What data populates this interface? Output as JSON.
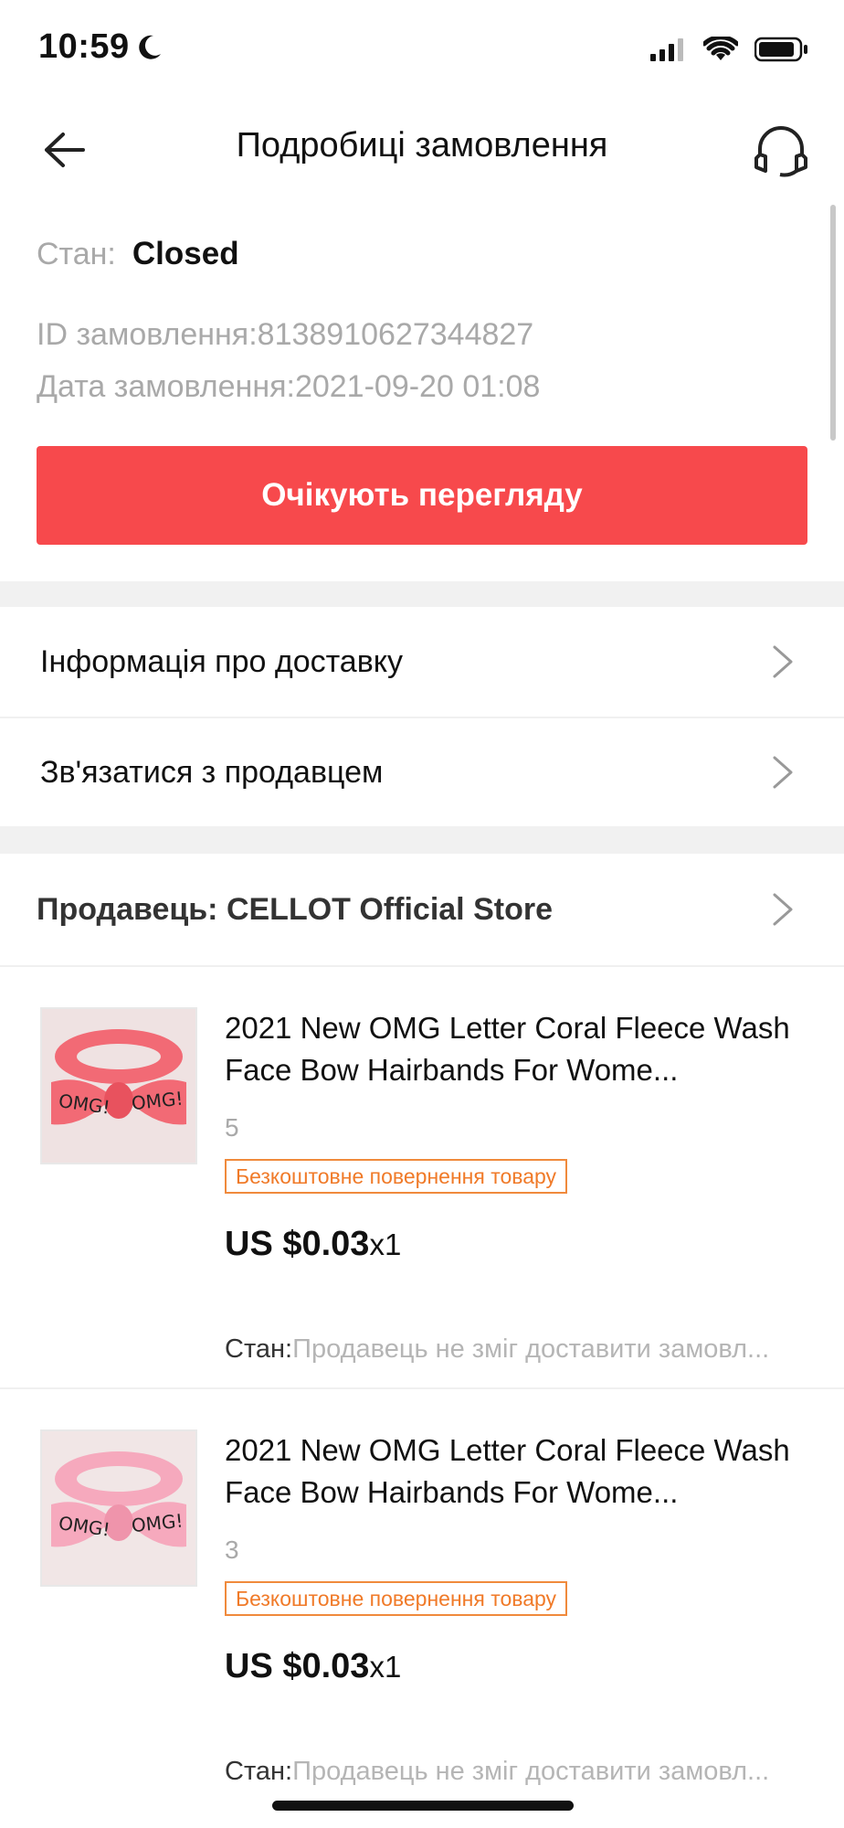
{
  "status_bar": {
    "time": "10:59"
  },
  "header": {
    "title": "Подробиці замовлення"
  },
  "order": {
    "state_label": "Стан:",
    "state_value": "Closed",
    "id_text": "ID замовлення:8138910627344827",
    "date_text": "Дата замовлення:2021-09-20 01:08",
    "button_label": "Очікують перегляду"
  },
  "menu": [
    {
      "label": "Інформація про доставку"
    },
    {
      "label": "Зв'язатися з продавцем"
    }
  ],
  "seller": {
    "label": "Продавець: CELLOT Official Store"
  },
  "products": [
    {
      "title": "2021 New OMG Letter Coral Fleece Wash Face Bow Hairbands For Wome...",
      "quantity": "5",
      "badge": "Безкоштовне повернення товару",
      "price": "US $0.03",
      "multiplier": "x1",
      "state_label": "Стан:",
      "state_text": "Продавець не зміг доставити замовл...",
      "image_text": "OMG!",
      "color": "#f26a75"
    },
    {
      "title": "2021 New OMG Letter Coral Fleece Wash Face Bow Hairbands For Wome...",
      "quantity": "3",
      "badge": "Безкоштовне повернення товару",
      "price": "US $0.03",
      "multiplier": "x1",
      "state_label": "Стан:",
      "state_text": "Продавець не зміг доставити замовл...",
      "image_text": "OMG!",
      "color": "#f6a9bd"
    }
  ],
  "colors": {
    "accent": "#f7494c",
    "badge": "#f07a28"
  }
}
